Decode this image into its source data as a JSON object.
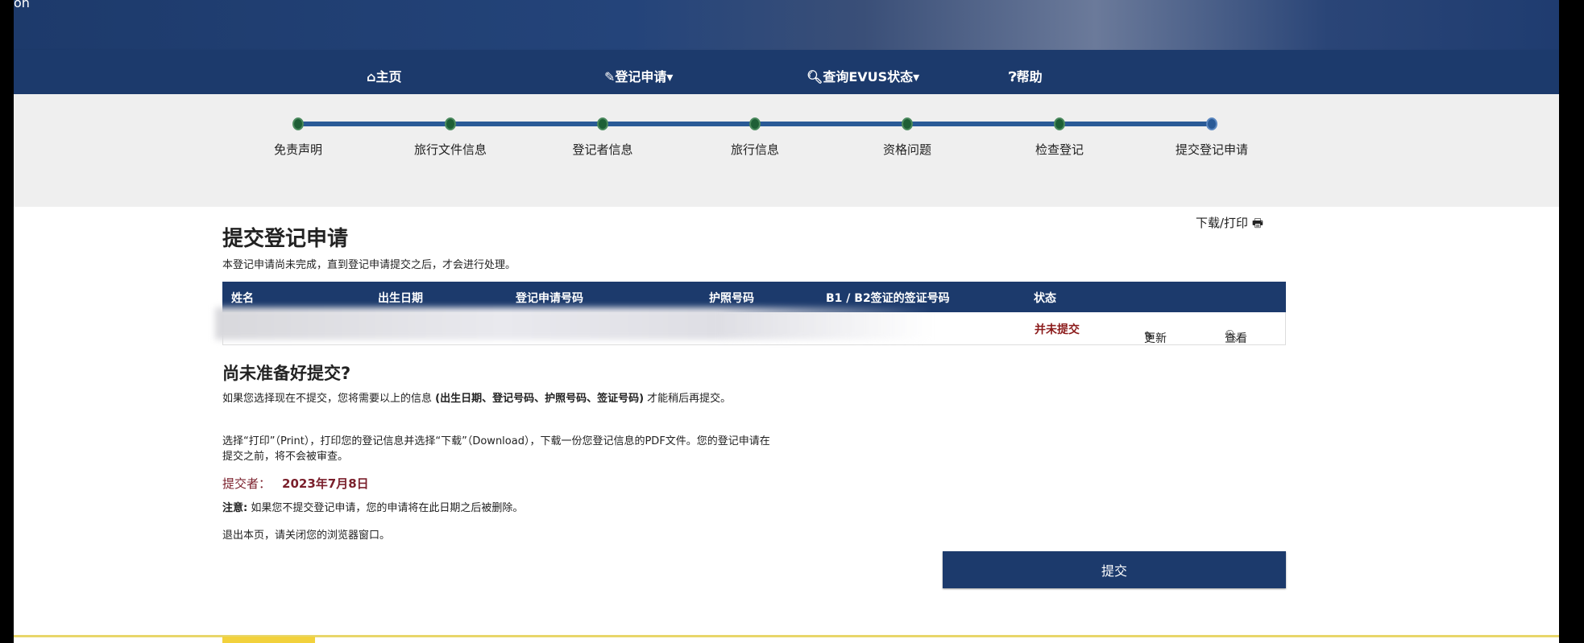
{
  "header": {
    "logo_fragment": "on"
  },
  "nav": [
    {
      "icon": "home-icon",
      "label": "主页"
    },
    {
      "icon": "pencil-icon",
      "label": "登记申请▾"
    },
    {
      "icon": "search-icon",
      "label": "查询EVUS状态▾"
    },
    {
      "icon": "help-icon",
      "label": "帮助"
    }
  ],
  "steps": [
    "免责声明",
    "旅行文件信息",
    "登记者信息",
    "旅行信息",
    "资格问题",
    "检查登记",
    "提交登记申请"
  ],
  "page": {
    "title": "提交登记申请",
    "download_print": "下载/打印",
    "subtitle": "本登记申请尚未完成，直到登记申请提交之后，才会进行处理。"
  },
  "table": {
    "headers": [
      "姓名",
      "出生日期",
      "登记申请号码",
      "护照号码",
      "B1 / B2签证的签证号码",
      "状态"
    ],
    "row": {
      "status": "并未提交",
      "update": "更新",
      "view": "查看"
    }
  },
  "not_ready": {
    "heading": "尚未准备好提交?",
    "p1_prefix": "如果您选择现在不提交，您将需要以上的信息 ",
    "p1_bold": "(出生日期、登记号码、护照号码、签证号码)",
    "p1_suffix": " 才能稍后再提交。",
    "p2": "选择“打印”（Print），打印您的登记信息并选择“下载”（Download），下载一份您登记信息的PDF文件。您的登记申请在提交之前，将不会被审查。",
    "submitter_label": "提交者：",
    "submitter_date": "2023年7月8日",
    "note_label": "注意:",
    "note": " 如果您不提交登记申请，您的申请将在此日期之后被删除。",
    "exit": "退出本页，请关闭您的浏览器窗口。"
  },
  "submit_label": "提交",
  "colors": {
    "navy": "#1c3a6c",
    "status": "#8b1a1a",
    "step_done": "#1e5f36"
  }
}
